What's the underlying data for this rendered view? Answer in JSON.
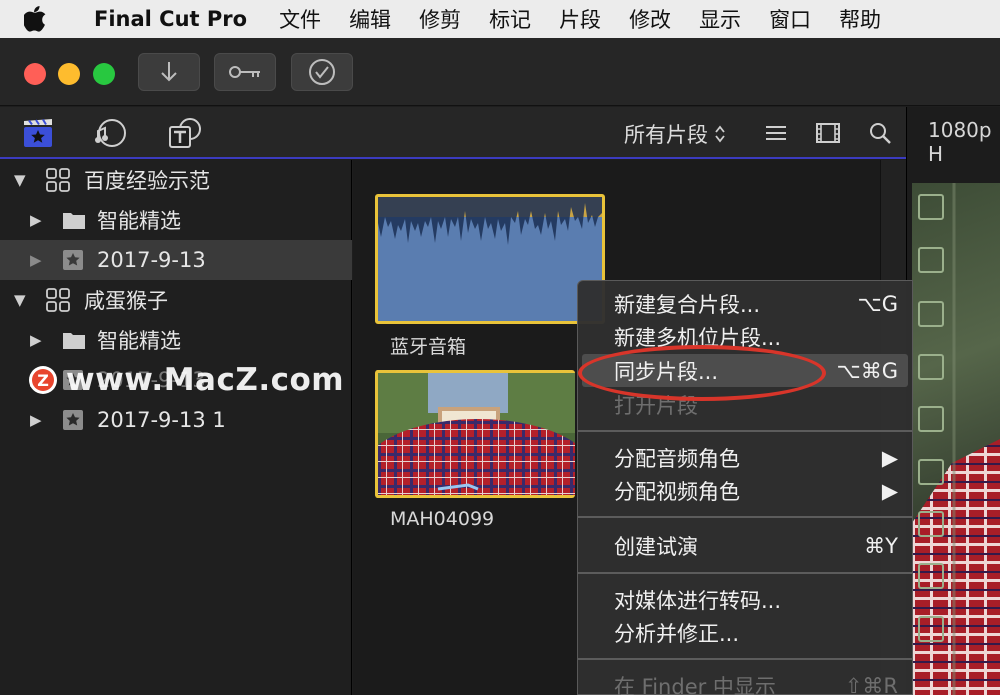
{
  "menubar": {
    "app_name": "Final Cut Pro",
    "items": [
      "文件",
      "编辑",
      "修剪",
      "标记",
      "片段",
      "修改",
      "显示",
      "窗口",
      "帮助"
    ]
  },
  "library_header": {
    "filter_label": "所有片段",
    "resolution_label": "1080p H"
  },
  "sidebar": {
    "rows": [
      {
        "label": "百度经验示范"
      },
      {
        "label": "智能精选"
      },
      {
        "label": "2017-9-13"
      },
      {
        "label": "咸蛋猴子"
      },
      {
        "label": "智能精选"
      },
      {
        "label": "2017-9-13"
      },
      {
        "label": "2017-9-13 1"
      }
    ]
  },
  "browser": {
    "clips": [
      {
        "label": "蓝牙音箱"
      },
      {
        "label": "MAH04099"
      }
    ]
  },
  "context_menu": {
    "items": [
      {
        "label": "新建复合片段...",
        "shortcut": "⌥G"
      },
      {
        "label": "新建多机位片段...",
        "shortcut": ""
      },
      {
        "label": "同步片段...",
        "shortcut": "⌥⌘G"
      },
      {
        "label": "打开片段",
        "shortcut": ""
      },
      {
        "label": "分配音频角色",
        "shortcut": "▶"
      },
      {
        "label": "分配视频角色",
        "shortcut": "▶"
      },
      {
        "label": "创建试演",
        "shortcut": "⌘Y"
      },
      {
        "label": "对媒体进行转码...",
        "shortcut": ""
      },
      {
        "label": "分析并修正...",
        "shortcut": ""
      },
      {
        "label": "在 Finder 中显示",
        "shortcut": "⇧⌘R"
      }
    ]
  },
  "watermark": {
    "text": "www.MacZ.com",
    "badge": "Z"
  },
  "colors": {
    "selection_yellow": "#e9c33a",
    "highlight_ring": "#d8352a",
    "accent_blue": "#3b3bbf"
  }
}
